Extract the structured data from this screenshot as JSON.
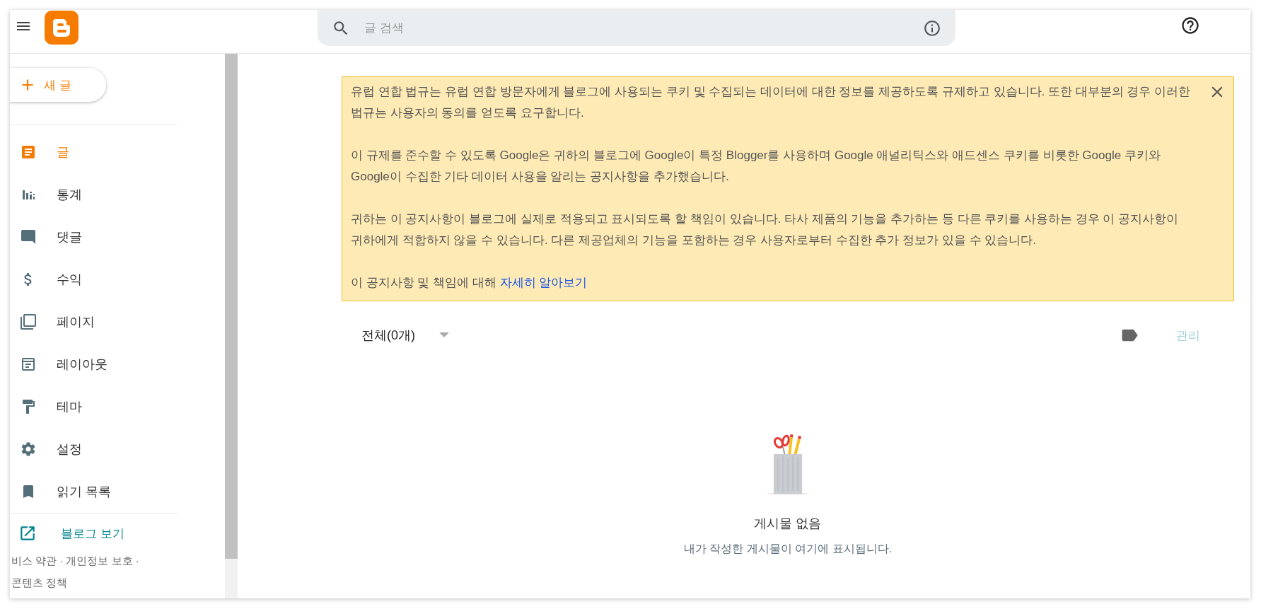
{
  "topbar": {
    "search": {
      "placeholder": "글 검색"
    }
  },
  "sidebar": {
    "new_post": "새 글",
    "items": [
      {
        "label": "글",
        "selected": true
      },
      {
        "label": "통계",
        "selected": false
      },
      {
        "label": "댓글",
        "selected": false
      },
      {
        "label": "수익",
        "selected": false
      },
      {
        "label": "페이지",
        "selected": false
      },
      {
        "label": "레이아웃",
        "selected": false
      },
      {
        "label": "테마",
        "selected": false
      },
      {
        "label": "설정",
        "selected": false
      },
      {
        "label": "읽기 목록",
        "selected": false
      }
    ],
    "view_blog": "블로그 보기",
    "footer_lines": [
      "비스 약관 · 개인정보 보호 ·",
      "콘텐츠 정책"
    ]
  },
  "notice": {
    "paragraphs": [
      "유럽 연합 법규는 유럽 연합 방문자에게 블로그에 사용되는 쿠키 및 수집되는 데이터에 대한 정보를 제공하도록 규제하고 있습니다. 또한 대부분의 경우 이러한 법규는 사용자의 동의를 얻도록 요구합니다.",
      "이 규제를 준수할 수 있도록 Google은 귀하의 블로그에 Google이 특정 Blogger를 사용하며 Google 애널리틱스와 애드센스 쿠키를 비롯한 Google 쿠키와 Google이 수집한 기타 데이터 사용을 알리는 공지사항을 추가했습니다.",
      "귀하는 이 공지사항이 블로그에 실제로 적용되고 표시되도록 할 책임이 있습니다. 타사 제품의 기능을 추가하는 등 다른 쿠키를 사용하는 경우 이 공지사항이 귀하에게 적합하지 않을 수 있습니다. 다른 제공업체의 기능을 포함하는 경우 사용자로부터 수집한 추가 정보가 있을 수 있습니다."
    ],
    "link_prefix": "이 공지사항 및 책임에 대해",
    "link": "자세히 알아보기"
  },
  "posts": {
    "filter": "전체(0개)",
    "manage": {
      "label": "관리",
      "disabled": true
    },
    "empty": {
      "title": "게시물 없음",
      "subtitle": "내가 작성한 게시물이 여기에 표시됩니다."
    }
  }
}
